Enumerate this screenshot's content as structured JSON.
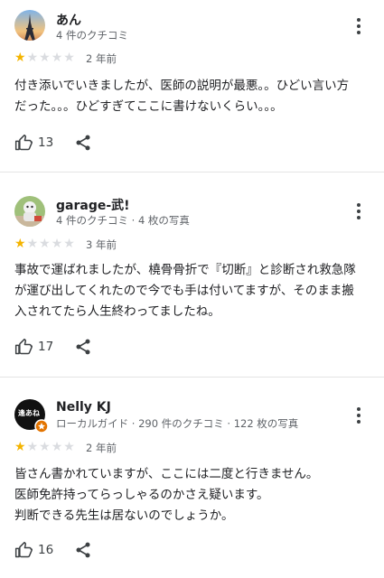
{
  "colors": {
    "star_on": "#f4b400",
    "star_off": "#dadce0",
    "divider": "#e4e4e4",
    "muted": "#5f6368"
  },
  "reviews": [
    {
      "name": "あん",
      "meta": "4 件のクチコミ",
      "rating": 1,
      "date": "2 年前",
      "text_lines": [
        "付き添いでいきましたが、医師の説明が最悪。。ひどい言い方",
        "だった。。。ひどすぎてここに書けないくらい。。。"
      ],
      "likes": "13",
      "avatar_icon": "eiffel-tower-photo"
    },
    {
      "name": "garage-武!",
      "meta": "4 件のクチコミ · 4 枚の写真",
      "rating": 1,
      "date": "3 年前",
      "text_lines": [
        "事故で運ばれましたが、橈骨骨折で『切断』と診断され救急隊",
        "が運び出してくれたので今でも手は付いてますが、そのまま搬",
        "入されてたら人生終わってましたね。"
      ],
      "likes": "17",
      "avatar_icon": "character-photo"
    },
    {
      "name": "Nelly KJ",
      "meta": "ローカルガイド · 290 件のクチコミ · 122 枚の写真",
      "rating": 1,
      "date": "2 年前",
      "text_lines": [
        "皆さん書かれていますが、ここには二度と行きません。",
        "医師免許持ってらっしゃるのかさえ疑います。",
        "判断できる先生は居ないのでしょうか。"
      ],
      "likes": "16",
      "avatar_icon": "logo-photo",
      "avatar_logo_text": "逢あね"
    }
  ]
}
